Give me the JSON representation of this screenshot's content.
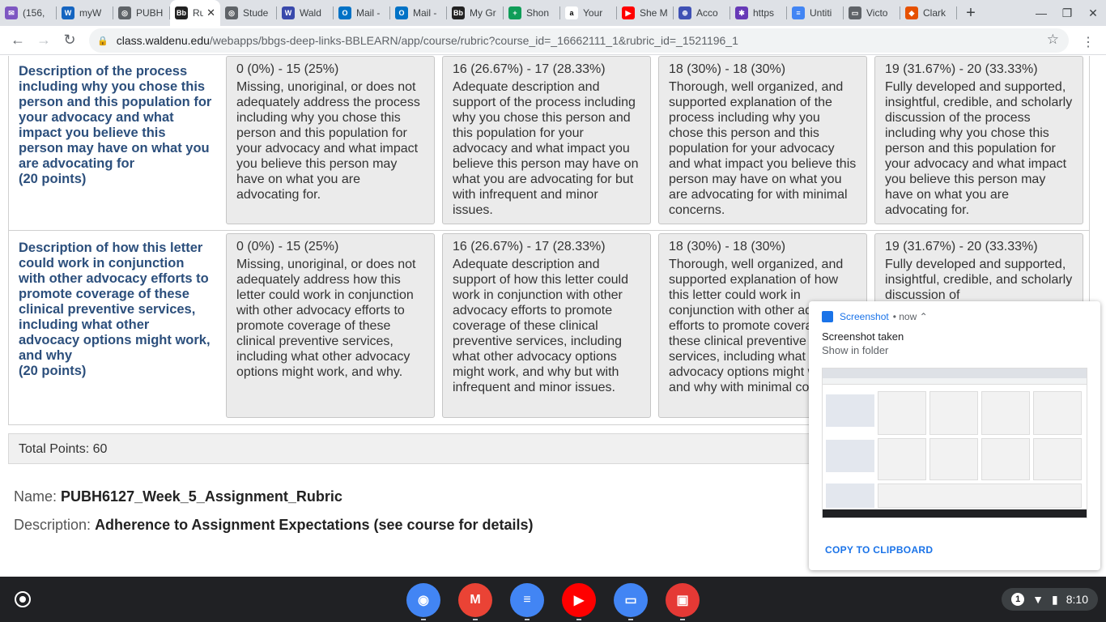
{
  "tabs": [
    {
      "title": "(156,",
      "icon": "gmail-icon",
      "color": "#7e57c2",
      "glyph": "✉"
    },
    {
      "title": "myW",
      "icon": "w-icon",
      "color": "#1565c0",
      "glyph": "W"
    },
    {
      "title": "PUBH",
      "icon": "globe-icon",
      "color": "#5f6368",
      "glyph": "◎"
    },
    {
      "title": "Ru",
      "icon": "blackboard-icon",
      "color": "#222222",
      "glyph": "Bb",
      "active": true
    },
    {
      "title": "Stude",
      "icon": "globe-icon",
      "color": "#5f6368",
      "glyph": "◎"
    },
    {
      "title": "Wald",
      "icon": "walden-icon",
      "color": "#3949ab",
      "glyph": "W"
    },
    {
      "title": "Mail -",
      "icon": "outlook-icon",
      "color": "#0072c6",
      "glyph": "O"
    },
    {
      "title": "Mail -",
      "icon": "outlook-icon",
      "color": "#0072c6",
      "glyph": "O"
    },
    {
      "title": "My Gr",
      "icon": "blackboard-icon",
      "color": "#222222",
      "glyph": "Bb"
    },
    {
      "title": "Shon",
      "icon": "sheets-icon",
      "color": "#0f9d58",
      "glyph": "+"
    },
    {
      "title": "Your",
      "icon": "amazon-icon",
      "color": "#ffffff",
      "glyph": "a"
    },
    {
      "title": "She M",
      "icon": "youtube-icon",
      "color": "#ff0000",
      "glyph": "▶"
    },
    {
      "title": "Acco",
      "icon": "globe-icon",
      "color": "#3f51b5",
      "glyph": "⊕"
    },
    {
      "title": "https",
      "icon": "globe-icon",
      "color": "#673ab7",
      "glyph": "✱"
    },
    {
      "title": "Untiti",
      "icon": "docs-icon",
      "color": "#4285f4",
      "glyph": "≡"
    },
    {
      "title": "Victo",
      "icon": "window-icon",
      "color": "#5f6368",
      "glyph": "▭"
    },
    {
      "title": "Clark",
      "icon": "clark-icon",
      "color": "#e65100",
      "glyph": "◆"
    }
  ],
  "browser": {
    "url_host": "class.waldenu.edu",
    "url_path": "/webapps/bbgs-deep-links-BBLEARN/app/course/rubric?course_id=_16662111_1&rubric_id=_1521196_1"
  },
  "rubric": {
    "rows": [
      {
        "criterion": "Description of the process including why you chose this person and this population for your advocacy and what impact you believe this person may have on what you are advocating for",
        "points": "(20 points)",
        "levels": [
          {
            "range": "0 (0%) - 15 (25%)",
            "desc": "Missing, unoriginal, or does not adequately address the process including why you chose this person and this population for your advocacy and what impact you believe this person may have on what you are advocating for."
          },
          {
            "range": "16 (26.67%) - 17 (28.33%)",
            "desc": "Adequate description and support of the process including why you chose this person and this population for your advocacy and what impact you believe this person may have on what you are advocating for but with infrequent and minor issues."
          },
          {
            "range": "18 (30%) - 18 (30%)",
            "desc": "Thorough, well organized, and supported explanation of the process including why you chose this person and this population for your advocacy and what impact you believe this person may have on what you are advocating for with minimal concerns."
          },
          {
            "range": "19 (31.67%) - 20 (33.33%)",
            "desc": "Fully developed and supported, insightful, credible, and scholarly discussion of the process including why you chose this person and this population for your advocacy and what impact you believe this person may have on what you are advocating for."
          }
        ]
      },
      {
        "criterion": "Description of how this letter could work in conjunction with other advocacy efforts to promote coverage of these clinical preventive services, including what other advocacy options might work, and why",
        "points": "(20 points)",
        "levels": [
          {
            "range": "0 (0%) - 15 (25%)",
            "desc": "Missing, unoriginal, or does not adequately address how this letter could work in conjunction with other advocacy efforts to promote coverage of these clinical preventive services, including what other advocacy options might work, and why."
          },
          {
            "range": "16 (26.67%) - 17 (28.33%)",
            "desc": "Adequate description and support of how this letter could work in conjunction with other advocacy efforts to promote coverage of these clinical preventive services, including what other advocacy options might work, and why but with infrequent and minor issues."
          },
          {
            "range": "18 (30%) - 18 (30%)",
            "desc": "Thorough, well organized, and supported explanation of how this letter could work in conjunction with other advocacy efforts to promote coverage of these clinical preventive services, including what other advocacy options might work, and why with minimal concerns."
          },
          {
            "range": "19 (31.67%) - 20 (33.33%)",
            "desc": "Fully developed and supported, insightful, credible, and scholarly discussion of"
          }
        ]
      }
    ],
    "total": "Total Points: 60",
    "name_label": "Name:",
    "name_value": "PUBH6127_Week_5_Assignment_Rubric",
    "description_label": "Description:",
    "description_value": "Adherence to Assignment Expectations (see course for details)"
  },
  "notification": {
    "app": "Screenshot",
    "time": "now",
    "title": "Screenshot taken",
    "subtitle": "Show in folder",
    "action": "COPY TO CLIPBOARD"
  },
  "shelf": {
    "apps": [
      {
        "name": "chrome-icon",
        "color": "#4285f4"
      },
      {
        "name": "gmail-icon",
        "color": "#ea4335"
      },
      {
        "name": "docs-icon",
        "color": "#4285f4"
      },
      {
        "name": "youtube-icon",
        "color": "#ff0000"
      },
      {
        "name": "files-icon",
        "color": "#4285f4"
      },
      {
        "name": "gallery-icon",
        "color": "#e53935"
      }
    ],
    "notif_count": "1",
    "time": "8:10"
  }
}
